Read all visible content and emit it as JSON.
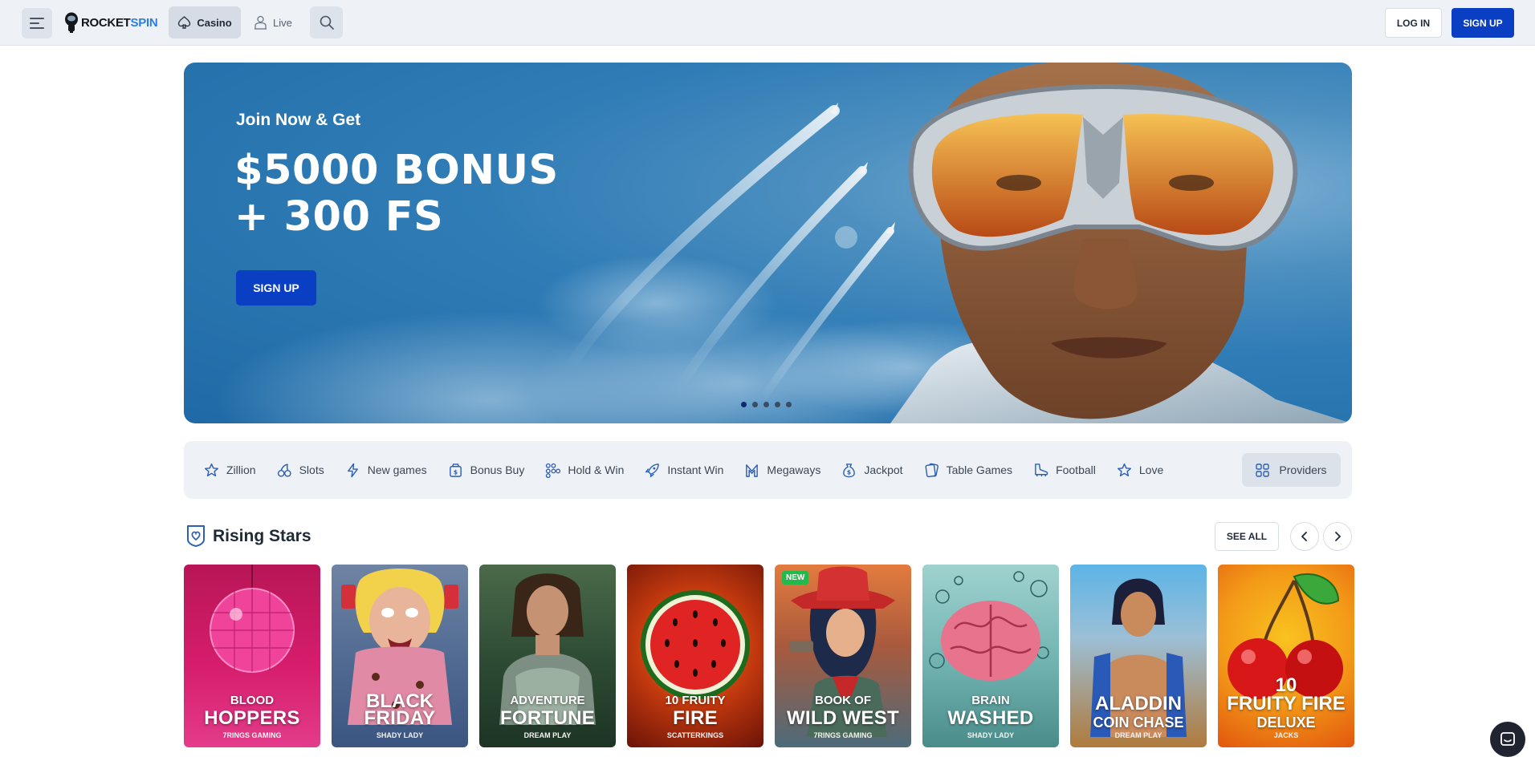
{
  "header": {
    "logo_a": "ROCKET",
    "logo_b": "SPIN",
    "nav": {
      "casino": "Casino",
      "live": "Live"
    },
    "login": "LOG IN",
    "signup": "SIGN UP"
  },
  "hero": {
    "kicker": "Join Now & Get",
    "title_line1": "$5000 BONUS",
    "title_line2": "+ 300 FS",
    "cta": "SIGN UP",
    "slides": 5,
    "active_slide": 1
  },
  "categories": {
    "items": [
      {
        "label": "Zillion",
        "icon": "star-icon"
      },
      {
        "label": "Slots",
        "icon": "cherries-icon"
      },
      {
        "label": "New games",
        "icon": "lightning-icon"
      },
      {
        "label": "Bonus Buy",
        "icon": "money-bag-icon"
      },
      {
        "label": "Hold & Win",
        "icon": "grid-icon"
      },
      {
        "label": "Instant Win",
        "icon": "rocket-icon"
      },
      {
        "label": "Megaways",
        "icon": "m-icon"
      },
      {
        "label": "Jackpot",
        "icon": "coin-bag-icon"
      },
      {
        "label": "Table Games",
        "icon": "cards-icon"
      },
      {
        "label": "Football",
        "icon": "boot-icon"
      },
      {
        "label": "Love",
        "icon": "star-icon"
      }
    ],
    "providers": "Providers"
  },
  "rising_stars": {
    "title": "Rising Stars",
    "see_all": "SEE ALL",
    "games": [
      {
        "sub": "BLOOD",
        "main": "HOPPERS",
        "provider": "7RINGS GAMING",
        "colors": [
          "#c2175b",
          "#e3207a"
        ]
      },
      {
        "main1": "BLACK",
        "main2": "FRIDAY",
        "provider": "SHADY LADY",
        "colors": [
          "#5a6f8f",
          "#3d5a82"
        ]
      },
      {
        "sub": "ADVENTURE",
        "main": "FORTUNE",
        "provider": "DREAM PLAY",
        "colors": [
          "#3a5a3c",
          "#1e3a26"
        ]
      },
      {
        "sub": "10 FRUITY",
        "main": "FIRE",
        "provider": "SCATTERKINGS",
        "colors": [
          "#e0531a",
          "#8a1e0a"
        ]
      },
      {
        "badge": "NEW",
        "sub": "BOOK OF",
        "main": "WILD WEST",
        "provider": "7RINGS GAMING",
        "colors": [
          "#d86a3c",
          "#4a6b78"
        ]
      },
      {
        "sub": "BRAIN",
        "main": "WASHED",
        "provider": "SHADY LADY",
        "colors": [
          "#7fc3c2",
          "#4a9a9a"
        ]
      },
      {
        "main1": "ALADDIN",
        "sub2": "COIN CHASE",
        "provider": "DREAM PLAY",
        "colors": [
          "#4aa3d8",
          "#b07a3c"
        ]
      },
      {
        "top": "10",
        "main1": "FRUITY FIRE",
        "sub2": "DELUXE",
        "provider": "JACKS",
        "colors": [
          "#f2a91a",
          "#e0560e"
        ]
      }
    ]
  }
}
